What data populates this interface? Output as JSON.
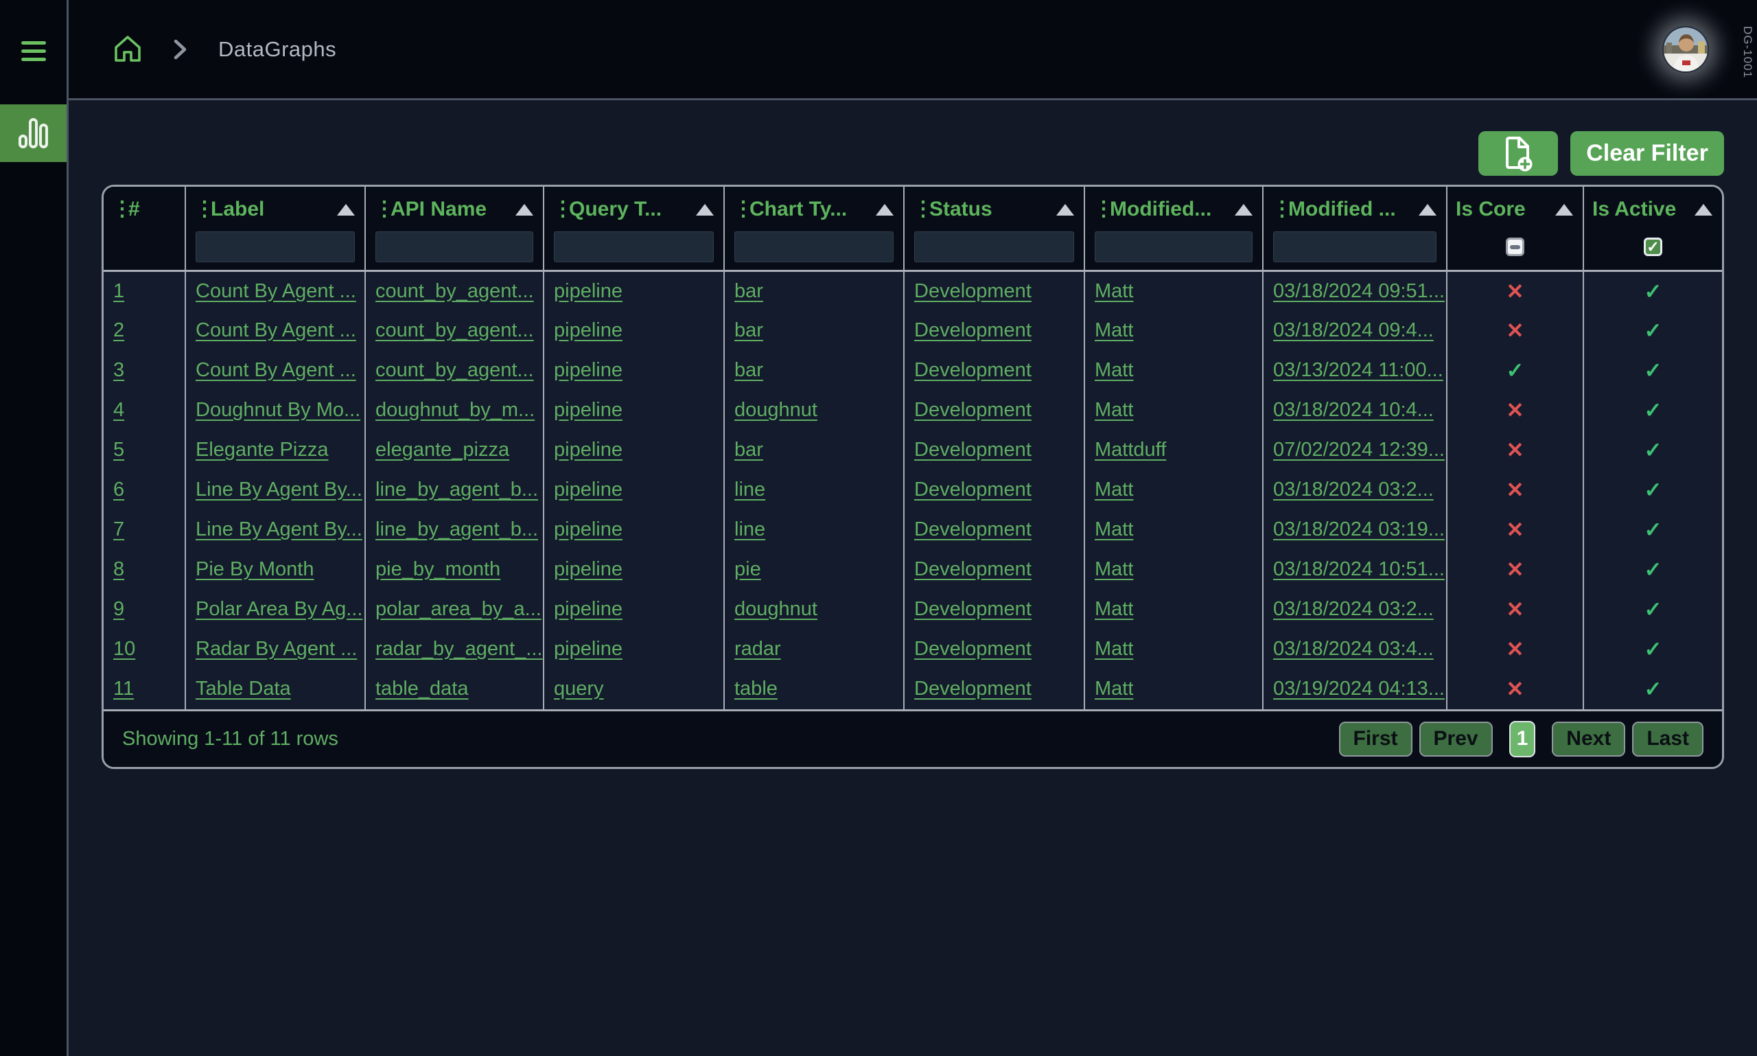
{
  "topbar": {
    "breadcrumb": "DataGraphs",
    "device_label": "DG-1001"
  },
  "toolbar": {
    "clear_filter_label": "Clear Filter"
  },
  "icons": {
    "drag_handle": "⋮",
    "check": "✓",
    "cross": "✕",
    "home": "home-icon",
    "breadcrumb_chevron": "chevron-right-icon",
    "add_file": "file-plus-icon",
    "sidebar_active": "bar-chart-icon",
    "menu": "hamburger-menu-icon"
  },
  "colors": {
    "accent_green": "#57a457",
    "link_green": "#5fae63",
    "check_green": "#3dc173",
    "error_red": "#e05353",
    "active_nav_green": "#4e8c44"
  },
  "table": {
    "columns": {
      "num": {
        "label": "#"
      },
      "label": {
        "label": "Label"
      },
      "api_name": {
        "label": "API Name"
      },
      "query_type": {
        "label": "Query T..."
      },
      "chart_type": {
        "label": "Chart Ty..."
      },
      "status": {
        "label": "Status"
      },
      "modified_by": {
        "label": "Modified..."
      },
      "modified_on": {
        "label": "Modified ..."
      },
      "is_core": {
        "label": "Is Core"
      },
      "is_active": {
        "label": "Is Active"
      }
    },
    "filters": {
      "is_core_state": "indeterminate",
      "is_active_state": "checked"
    },
    "rows": [
      {
        "num": "1",
        "label": "Count By Agent ...",
        "api_name": "count_by_agent...",
        "query_type": "pipeline",
        "chart_type": "bar",
        "status": "Development",
        "modified_by": "Matt",
        "modified_on": "03/18/2024 09:51...",
        "is_core": {
          "glyph": "✕",
          "state": "no"
        },
        "is_active": {
          "glyph": "✓",
          "state": "yes"
        }
      },
      {
        "num": "2",
        "label": "Count By Agent ...",
        "api_name": "count_by_agent...",
        "query_type": "pipeline",
        "chart_type": "bar",
        "status": "Development",
        "modified_by": "Matt",
        "modified_on": "03/18/2024 09:4...",
        "is_core": {
          "glyph": "✕",
          "state": "no"
        },
        "is_active": {
          "glyph": "✓",
          "state": "yes"
        }
      },
      {
        "num": "3",
        "label": "Count By Agent ...",
        "api_name": "count_by_agent...",
        "query_type": "pipeline",
        "chart_type": "bar",
        "status": "Development",
        "modified_by": "Matt",
        "modified_on": "03/13/2024 11:00...",
        "is_core": {
          "glyph": "✓",
          "state": "yes"
        },
        "is_active": {
          "glyph": "✓",
          "state": "yes"
        }
      },
      {
        "num": "4",
        "label": "Doughnut By Mo...",
        "api_name": "doughnut_by_m...",
        "query_type": "pipeline",
        "chart_type": "doughnut",
        "status": "Development",
        "modified_by": "Matt",
        "modified_on": "03/18/2024 10:4...",
        "is_core": {
          "glyph": "✕",
          "state": "no"
        },
        "is_active": {
          "glyph": "✓",
          "state": "yes"
        }
      },
      {
        "num": "5",
        "label": "Elegante Pizza",
        "api_name": "elegante_pizza",
        "query_type": "pipeline",
        "chart_type": "bar",
        "status": "Development",
        "modified_by": "Mattduff",
        "modified_on": "07/02/2024 12:39...",
        "is_core": {
          "glyph": "✕",
          "state": "no"
        },
        "is_active": {
          "glyph": "✓",
          "state": "yes"
        }
      },
      {
        "num": "6",
        "label": "Line By Agent By...",
        "api_name": "line_by_agent_b...",
        "query_type": "pipeline",
        "chart_type": "line",
        "status": "Development",
        "modified_by": "Matt",
        "modified_on": "03/18/2024 03:2...",
        "is_core": {
          "glyph": "✕",
          "state": "no"
        },
        "is_active": {
          "glyph": "✓",
          "state": "yes"
        }
      },
      {
        "num": "7",
        "label": "Line By Agent By...",
        "api_name": "line_by_agent_b...",
        "query_type": "pipeline",
        "chart_type": "line",
        "status": "Development",
        "modified_by": "Matt",
        "modified_on": "03/18/2024 03:19...",
        "is_core": {
          "glyph": "✕",
          "state": "no"
        },
        "is_active": {
          "glyph": "✓",
          "state": "yes"
        }
      },
      {
        "num": "8",
        "label": "Pie By Month",
        "api_name": "pie_by_month",
        "query_type": "pipeline",
        "chart_type": "pie",
        "status": "Development",
        "modified_by": "Matt",
        "modified_on": "03/18/2024 10:51...",
        "is_core": {
          "glyph": "✕",
          "state": "no"
        },
        "is_active": {
          "glyph": "✓",
          "state": "yes"
        }
      },
      {
        "num": "9",
        "label": "Polar Area By Ag...",
        "api_name": "polar_area_by_a...",
        "query_type": "pipeline",
        "chart_type": "doughnut",
        "status": "Development",
        "modified_by": "Matt",
        "modified_on": "03/18/2024 03:2...",
        "is_core": {
          "glyph": "✕",
          "state": "no"
        },
        "is_active": {
          "glyph": "✓",
          "state": "yes"
        }
      },
      {
        "num": "10",
        "label": "Radar By Agent ...",
        "api_name": "radar_by_agent_...",
        "query_type": "pipeline",
        "chart_type": "radar",
        "status": "Development",
        "modified_by": "Matt",
        "modified_on": "03/18/2024 03:4...",
        "is_core": {
          "glyph": "✕",
          "state": "no"
        },
        "is_active": {
          "glyph": "✓",
          "state": "yes"
        }
      },
      {
        "num": "11",
        "label": "Table Data",
        "api_name": "table_data",
        "query_type": "query",
        "chart_type": "table",
        "status": "Development",
        "modified_by": "Matt",
        "modified_on": "03/19/2024 04:13...",
        "is_core": {
          "glyph": "✕",
          "state": "no"
        },
        "is_active": {
          "glyph": "✓",
          "state": "yes"
        }
      }
    ],
    "footer": {
      "summary": "Showing 1-11 of 11 rows",
      "pagination": {
        "first": "First",
        "prev": "Prev",
        "page": "1",
        "next": "Next",
        "last": "Last"
      }
    }
  }
}
